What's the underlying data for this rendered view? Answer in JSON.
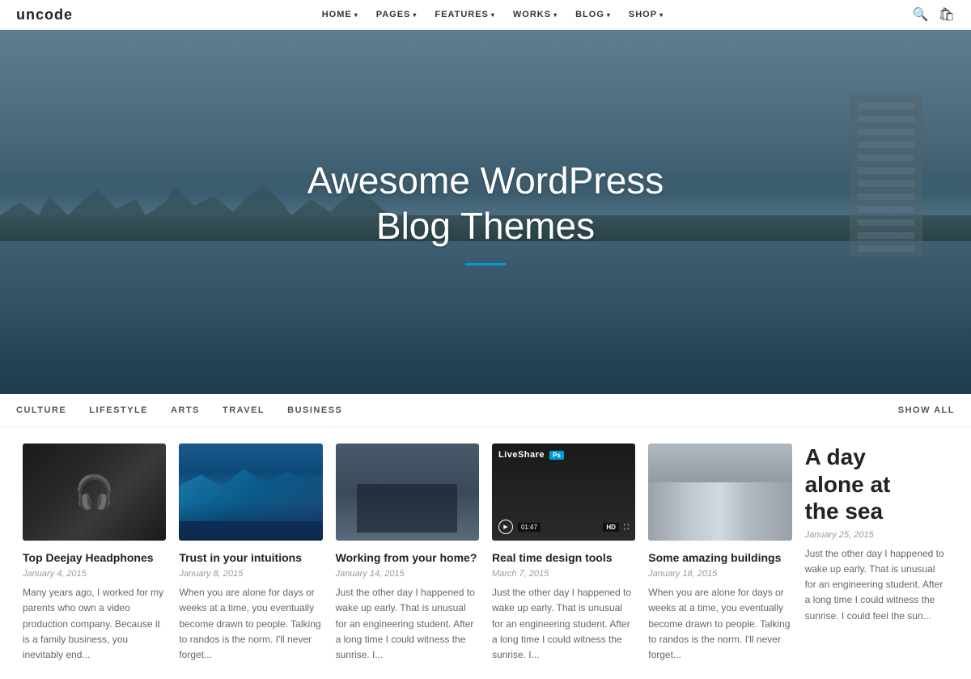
{
  "nav": {
    "logo": "uncode",
    "items": [
      {
        "label": "HOME",
        "hasDropdown": true
      },
      {
        "label": "PAGES",
        "hasDropdown": true
      },
      {
        "label": "FEATURES",
        "hasDropdown": true
      },
      {
        "label": "WORKS",
        "hasDropdown": true
      },
      {
        "label": "BLOG",
        "hasDropdown": true
      },
      {
        "label": "SHOP",
        "hasDropdown": true
      }
    ]
  },
  "hero": {
    "title_line1": "Awesome WordPress",
    "title_line2": "Blog Themes"
  },
  "categories": {
    "items": [
      {
        "label": "CULTURE"
      },
      {
        "label": "LIFESTYLE"
      },
      {
        "label": "ARTS"
      },
      {
        "label": "TRAVEL"
      },
      {
        "label": "BUSINESS"
      }
    ],
    "show_all": "SHOW ALL"
  },
  "posts": [
    {
      "id": "post-1",
      "title": "Top Deejay Headphones",
      "date": "January 4, 2015",
      "excerpt": "Many years ago, I worked for my parents who own a video production company. Because it is a family business, you inevitably end...",
      "image_type": "headphones"
    },
    {
      "id": "post-2",
      "title": "Trust in your intuitions",
      "date": "January 8, 2015",
      "excerpt": "When you are alone for days or weeks at a time, you eventually become drawn to people. Talking to randos is the norm. I'll never forget...",
      "image_type": "waves"
    },
    {
      "id": "post-3",
      "title": "Working from your home?",
      "date": "January 14, 2015",
      "excerpt": "Just the other day I happened to wake up early. That is unusual for an engineering student. After a long time I could witness the sunrise. I...",
      "image_type": "laptop"
    },
    {
      "id": "post-4",
      "title": "Real time design tools",
      "date": "March 7, 2015",
      "excerpt": "Just the other day I happened to wake up early. That is unusual for an engineering student. After a long time I could witness the sunrise. I...",
      "image_type": "liveshare",
      "video_label": "LiveShare",
      "video_time": "01:47"
    },
    {
      "id": "post-5",
      "title": "Some amazing buildings",
      "date": "January 18, 2015",
      "excerpt": "When you are alone for days or weeks at a time, you eventually become drawn to people. Talking to randos is the norm. I'll never forget...",
      "image_type": "buildings"
    },
    {
      "id": "post-6",
      "title": "A day alone at the sea",
      "date": "January 25, 2015",
      "excerpt": "Just the other day I happened to wake up early. That is unusual for an engineering student. After a long time I could witness the sunrise. I could feel the sun...",
      "image_type": "text-only"
    }
  ]
}
